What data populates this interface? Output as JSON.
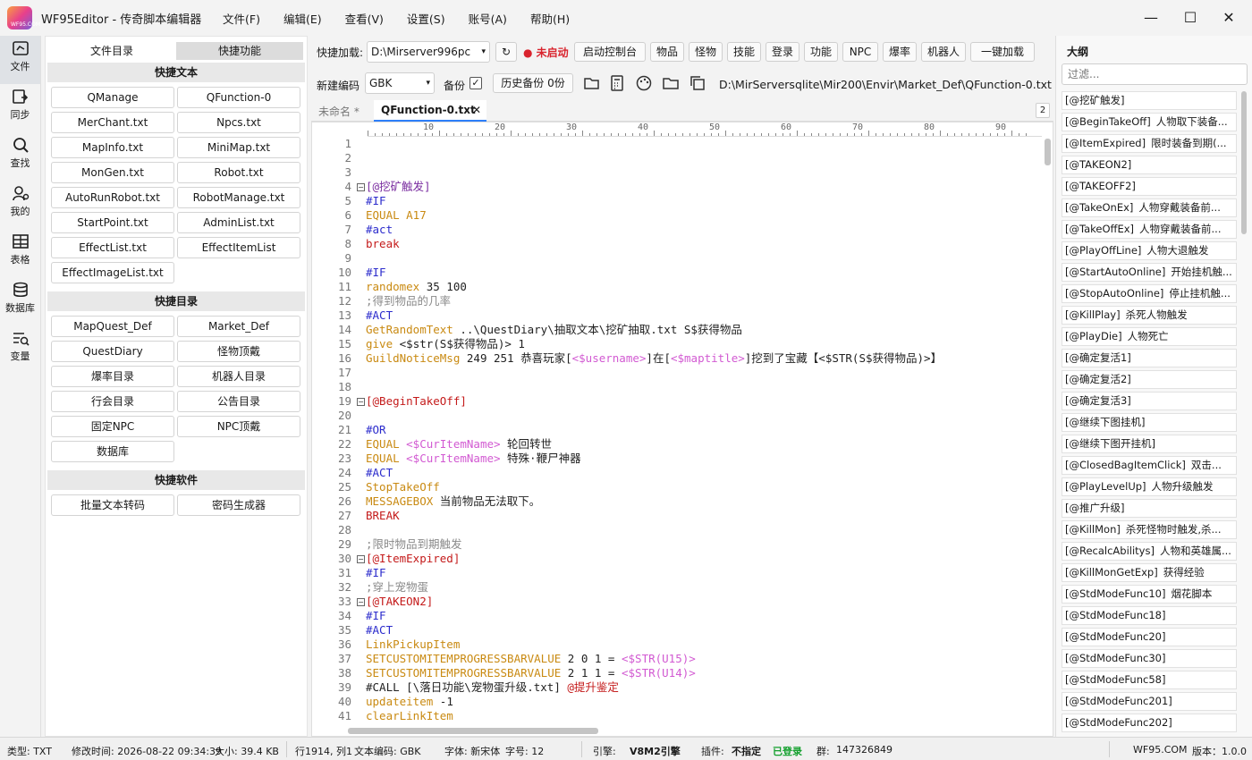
{
  "app": {
    "logo_text": "WF95.COM",
    "title": "WF95Editor - 传奇脚本编辑器",
    "menu": [
      "文件(F)",
      "编辑(E)",
      "查看(V)",
      "设置(S)",
      "账号(A)",
      "帮助(H)"
    ]
  },
  "window_controls": {
    "min": "—",
    "max": "☐",
    "close": "✕"
  },
  "rail": [
    {
      "label": "文件",
      "icon": "file-icon"
    },
    {
      "label": "同步",
      "icon": "sync-icon"
    },
    {
      "label": "查找",
      "icon": "search-icon"
    },
    {
      "label": "我的",
      "icon": "user-icon"
    },
    {
      "label": "表格",
      "icon": "table-icon"
    },
    {
      "label": "数据库",
      "icon": "database-icon"
    },
    {
      "label": "变量",
      "icon": "variable-icon"
    }
  ],
  "panel": {
    "tabs": [
      "文件目录",
      "快捷功能"
    ],
    "quick_text_head": "快捷文本",
    "quick_text": [
      "QManage",
      "QFunction-0",
      "MerChant.txt",
      "Npcs.txt",
      "MapInfo.txt",
      "MiniMap.txt",
      "MonGen.txt",
      "Robot.txt",
      "AutoRunRobot.txt",
      "RobotManage.txt",
      "StartPoint.txt",
      "AdminList.txt",
      "EffectList.txt",
      "EffectItemList",
      "EffectImageList.txt"
    ],
    "quick_dir_head": "快捷目录",
    "quick_dir": [
      "MapQuest_Def",
      "Market_Def",
      "QuestDiary",
      "怪物顶戴",
      "爆率目录",
      "机器人目录",
      "行会目录",
      "公告目录",
      "固定NPC",
      "NPC顶戴",
      "数据库"
    ],
    "quick_soft_head": "快捷软件",
    "quick_soft": [
      "批量文本转码",
      "密码生成器"
    ]
  },
  "toolbar1": {
    "label": "快捷加载:",
    "path": "D:\\Mirserver996pc",
    "refresh": "↻",
    "status": "未启动",
    "buttons": [
      "启动控制台",
      "物品",
      "怪物",
      "技能",
      "登录",
      "功能",
      "NPC",
      "爆率",
      "机器人",
      "一键加载"
    ]
  },
  "toolbar2": {
    "label": "新建编码",
    "encoding": "GBK",
    "backup_label": "备份",
    "history_btn": "历史备份 0份",
    "file_path": "D:\\MirServersqlite\\Mir200\\Envir\\Market_Def\\QFunction-0.txt"
  },
  "tabs": {
    "unnamed": "未命名 *",
    "active": "QFunction-0.txt",
    "count": "2"
  },
  "ruler": [
    "10",
    "20",
    "30",
    "40",
    "50",
    "60",
    "70",
    "80",
    "90"
  ],
  "code_lines": [
    [],
    [],
    [],
    [
      {
        "t": "[@挖矿触发]",
        "c": "#7a2da0"
      }
    ],
    [
      {
        "t": "#IF",
        "c": "#2c2ccc"
      }
    ],
    [
      {
        "t": "EQUAL A17",
        "c": "#c98a12"
      }
    ],
    [
      {
        "t": "#act",
        "c": "#2c2ccc"
      }
    ],
    [
      {
        "t": "break",
        "c": "#c41b1b"
      }
    ],
    [],
    [
      {
        "t": "#IF",
        "c": "#2c2ccc"
      }
    ],
    [
      {
        "t": "randomex ",
        "c": "#c98a12"
      },
      {
        "t": "35 100",
        "c": "#222"
      }
    ],
    [
      {
        "t": ";得到物品的几率",
        "c": "#8a8a8a"
      }
    ],
    [
      {
        "t": "#ACT",
        "c": "#2c2ccc"
      }
    ],
    [
      {
        "t": "GetRandomText ",
        "c": "#c98a12"
      },
      {
        "t": "..\\QuestDiary\\抽取文本\\挖矿抽取.txt S$获得物品",
        "c": "#222"
      }
    ],
    [
      {
        "t": "give ",
        "c": "#c98a12"
      },
      {
        "t": "<$str(S$获得物品)> 1",
        "c": "#222"
      }
    ],
    [
      {
        "t": "GuildNoticeMsg ",
        "c": "#c98a12"
      },
      {
        "t": "249 251 恭喜玩家[",
        "c": "#222"
      },
      {
        "t": "<$username>",
        "c": "#d25ad2"
      },
      {
        "t": "]在[",
        "c": "#222"
      },
      {
        "t": "<$maptitle>",
        "c": "#d25ad2"
      },
      {
        "t": "]挖到了宝藏【<$STR(S$获得物品)>】",
        "c": "#222"
      }
    ],
    [],
    [],
    [
      {
        "t": "[@BeginTakeOff]",
        "c": "#c41b1b"
      }
    ],
    [],
    [
      {
        "t": "#OR",
        "c": "#2c2ccc"
      }
    ],
    [
      {
        "t": "EQUAL ",
        "c": "#c98a12"
      },
      {
        "t": "<$CurItemName>",
        "c": "#d25ad2"
      },
      {
        "t": " 轮回转世",
        "c": "#222"
      }
    ],
    [
      {
        "t": "EQUAL ",
        "c": "#c98a12"
      },
      {
        "t": "<$CurItemName>",
        "c": "#d25ad2"
      },
      {
        "t": " 特殊·鞭尸神器",
        "c": "#222"
      }
    ],
    [
      {
        "t": "#ACT",
        "c": "#2c2ccc"
      }
    ],
    [
      {
        "t": "StopTakeOff",
        "c": "#c98a12"
      }
    ],
    [
      {
        "t": "MESSAGEBOX ",
        "c": "#c98a12"
      },
      {
        "t": "当前物品无法取下。",
        "c": "#222"
      }
    ],
    [
      {
        "t": "BREAK",
        "c": "#c41b1b"
      }
    ],
    [],
    [
      {
        "t": ";限时物品到期触发",
        "c": "#8a8a8a"
      }
    ],
    [
      {
        "t": "[@ItemExpired]",
        "c": "#c41b1b"
      }
    ],
    [
      {
        "t": "#IF",
        "c": "#2c2ccc"
      }
    ],
    [
      {
        "t": ";穿上宠物蛋",
        "c": "#8a8a8a"
      }
    ],
    [
      {
        "t": "[@TAKEON2]",
        "c": "#c41b1b"
      }
    ],
    [
      {
        "t": "#IF",
        "c": "#2c2ccc"
      }
    ],
    [
      {
        "t": "#ACT",
        "c": "#2c2ccc"
      }
    ],
    [
      {
        "t": "LinkPickupItem",
        "c": "#c98a12"
      }
    ],
    [
      {
        "t": "SETCUSTOMITEMPROGRESSBARVALUE ",
        "c": "#c98a12"
      },
      {
        "t": "2 0 1 = ",
        "c": "#222"
      },
      {
        "t": "<$STR(U15)>",
        "c": "#d25ad2"
      }
    ],
    [
      {
        "t": "SETCUSTOMITEMPROGRESSBARVALUE ",
        "c": "#c98a12"
      },
      {
        "t": "2 1 1 = ",
        "c": "#222"
      },
      {
        "t": "<$STR(U14)>",
        "c": "#d25ad2"
      }
    ],
    [
      {
        "t": "#CALL [\\落日功能\\宠物蛋升级.txt] ",
        "c": "#222"
      },
      {
        "t": "@提升鉴定",
        "c": "#c41b1b"
      }
    ],
    [
      {
        "t": "updateitem ",
        "c": "#c98a12"
      },
      {
        "t": "-1",
        "c": "#222"
      }
    ],
    [
      {
        "t": "clearLinkItem",
        "c": "#c98a12"
      }
    ]
  ],
  "outline": {
    "title": "大纲",
    "filter_placeholder": "过滤...",
    "items": [
      {
        "label": "[@挖矿触发]",
        "desc": ""
      },
      {
        "label": "[@BeginTakeOff]",
        "desc": "人物取下装备..."
      },
      {
        "label": "[@ItemExpired]",
        "desc": "限时装备到期(..."
      },
      {
        "label": "[@TAKEON2]",
        "desc": ""
      },
      {
        "label": "[@TAKEOFF2]",
        "desc": ""
      },
      {
        "label": "[@TakeOnEx]",
        "desc": "人物穿戴装备前..."
      },
      {
        "label": "[@TakeOffEx]",
        "desc": "人物穿戴装备前..."
      },
      {
        "label": "[@PlayOffLine]",
        "desc": "人物大退触发"
      },
      {
        "label": "[@StartAutoOnline]",
        "desc": "开始挂机触..."
      },
      {
        "label": "[@StopAutoOnline]",
        "desc": "停止挂机触..."
      },
      {
        "label": "[@KillPlay]",
        "desc": "杀死人物触发"
      },
      {
        "label": "[@PlayDie]",
        "desc": "人物死亡"
      },
      {
        "label": "[@确定复活1]",
        "desc": ""
      },
      {
        "label": "[@确定复活2]",
        "desc": ""
      },
      {
        "label": "[@确定复活3]",
        "desc": ""
      },
      {
        "label": "[@继续下图挂机]",
        "desc": ""
      },
      {
        "label": "[@继续下图开挂机]",
        "desc": ""
      },
      {
        "label": "[@ClosedBagItemClick]",
        "desc": "双击..."
      },
      {
        "label": "[@PlayLevelUp]",
        "desc": "人物升级触发"
      },
      {
        "label": "[@推广升级]",
        "desc": ""
      },
      {
        "label": "[@KillMon]",
        "desc": "杀死怪物时触发,杀..."
      },
      {
        "label": "[@RecalcAbilitys]",
        "desc": "人物和英雄属..."
      },
      {
        "label": "[@KillMonGetExp]",
        "desc": "获得经验"
      },
      {
        "label": "[@StdModeFunc10]",
        "desc": "烟花脚本"
      },
      {
        "label": "[@StdModeFunc18]",
        "desc": ""
      },
      {
        "label": "[@StdModeFunc20]",
        "desc": ""
      },
      {
        "label": "[@StdModeFunc30]",
        "desc": ""
      },
      {
        "label": "[@StdModeFunc58]",
        "desc": ""
      },
      {
        "label": "[@StdModeFunc201]",
        "desc": ""
      },
      {
        "label": "[@StdModeFunc202]",
        "desc": ""
      }
    ]
  },
  "status": {
    "type": "类型: TXT",
    "modified": "修改时间: 2026-08-22 09:34:39",
    "size": "大小: 39.4 KB",
    "cursor": "行1914, 列1",
    "encoding": "文本编码: GBK",
    "font": "字体: 新宋体",
    "fontsize": "字号: 12",
    "engine_label": "引擎:",
    "engine": "V8M2引擎",
    "plugin_label": "插件:",
    "plugin": "不指定",
    "login": "已登录",
    "group_label": "群:",
    "group": "147326849",
    "site": "WF95.COM",
    "version": "版本：1.0.0"
  },
  "colors": {
    "accent": "#2d7ff9",
    "not_started": "#d9232d",
    "logged_in": "#14a02e"
  }
}
